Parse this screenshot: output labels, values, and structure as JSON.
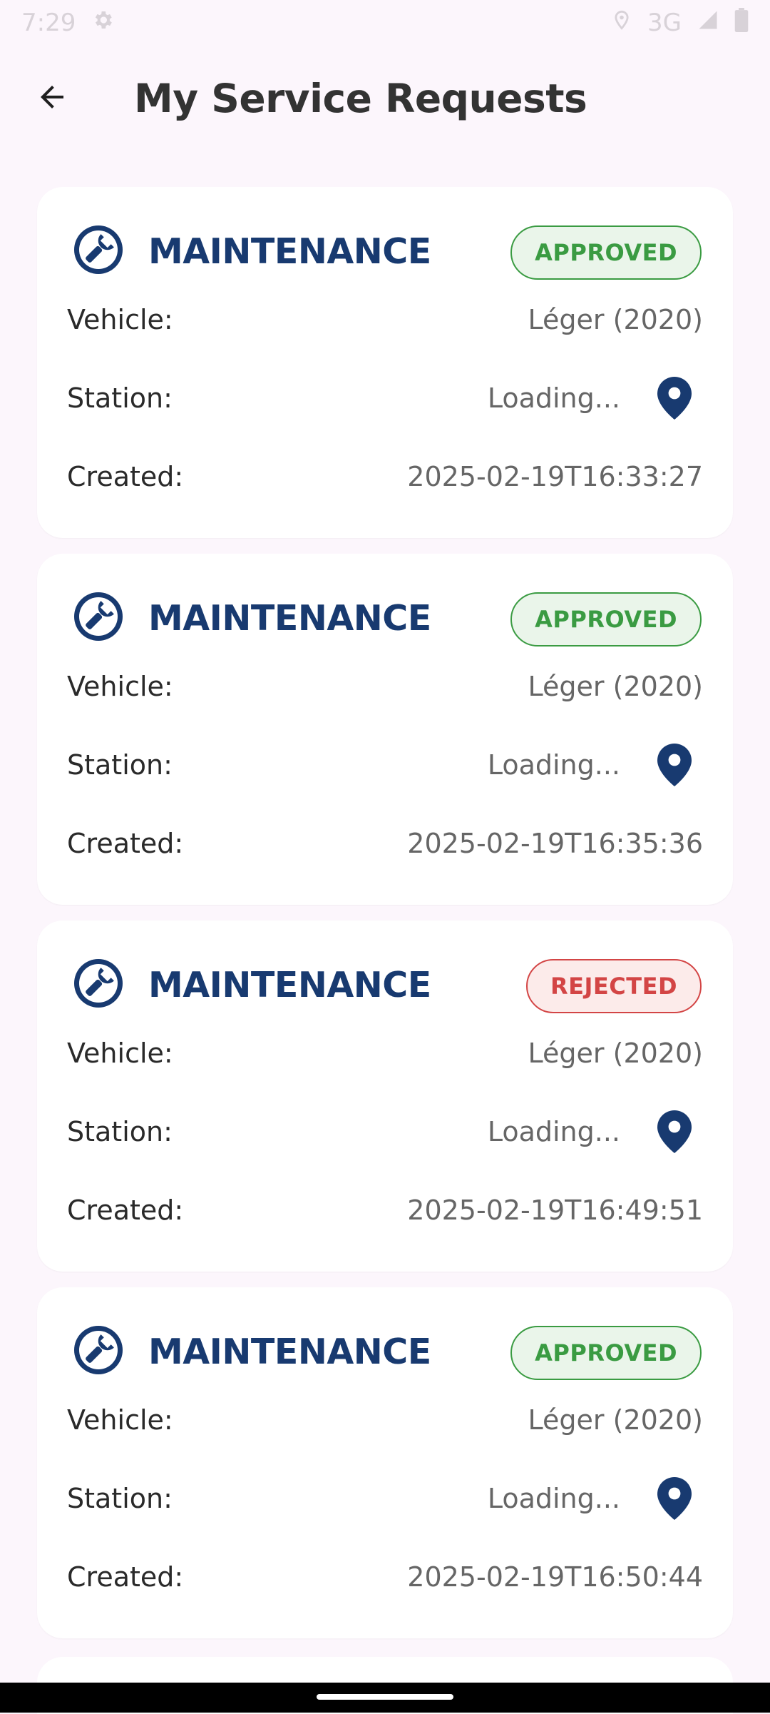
{
  "status_bar": {
    "time": "7:29",
    "network": "3G",
    "icons": [
      "gear-icon",
      "location-icon",
      "signal-icon",
      "battery-icon"
    ]
  },
  "app_bar": {
    "title": "My Service Requests",
    "back_icon": "arrow-left-icon"
  },
  "labels": {
    "vehicle": "Vehicle:",
    "station": "Station:",
    "created": "Created:"
  },
  "requests": [
    {
      "category": "MAINTENANCE",
      "status": "APPROVED",
      "vehicle": "Léger (2020)",
      "station": "Loading...",
      "created": "2025-02-19T16:33:27"
    },
    {
      "category": "MAINTENANCE",
      "status": "APPROVED",
      "vehicle": "Léger (2020)",
      "station": "Loading...",
      "created": "2025-02-19T16:35:36"
    },
    {
      "category": "MAINTENANCE",
      "status": "REJECTED",
      "vehicle": "Léger (2020)",
      "station": "Loading...",
      "created": "2025-02-19T16:49:51"
    },
    {
      "category": "MAINTENANCE",
      "status": "APPROVED",
      "vehicle": "Léger (2020)",
      "station": "Loading...",
      "created": "2025-02-19T16:50:44"
    }
  ],
  "colors": {
    "primary": "#183a70",
    "approved": "#3a9b42",
    "rejected": "#d34545",
    "background": "#fcf6fc"
  }
}
